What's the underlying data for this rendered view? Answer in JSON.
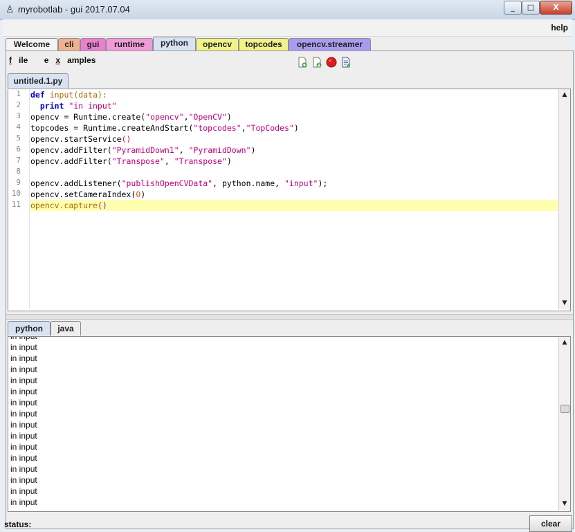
{
  "window": {
    "title": "myrobotlab - gui 2017.07.04",
    "min": "_",
    "max": "□",
    "close": "X"
  },
  "menu": {
    "help": "help"
  },
  "tabs": [
    {
      "label": "Welcome",
      "color": "#f4f4f4"
    },
    {
      "label": "cli",
      "color": "#f1b18e"
    },
    {
      "label": "gui",
      "color": "#ec7fd1"
    },
    {
      "label": "runtime",
      "color": "#f19ad9"
    },
    {
      "label": "python",
      "color": "#d7e3f3"
    },
    {
      "label": "opencv",
      "color": "#f2f28a"
    },
    {
      "label": "topcodes",
      "color": "#f2f28a"
    },
    {
      "label": "opencv.streamer",
      "color": "#a99cf0"
    }
  ],
  "python_panel": {
    "file_first": "f",
    "file_rest": "ile",
    "examples_pre": "e",
    "examples_u": "x",
    "examples_post": "amples",
    "toolbar": [
      "new-file-icon",
      "open-file-icon",
      "stop-icon",
      "save-file-icon"
    ],
    "doc_tab": "untitled.1.py"
  },
  "code": {
    "line_numbers": [
      "1",
      "2",
      "3",
      "4",
      "5",
      "6",
      "7",
      "8",
      "9",
      "10",
      "11"
    ],
    "lines": [
      [
        {
          "t": "def ",
          "c": "kw"
        },
        {
          "t": "input",
          "c": "fn"
        },
        {
          "t": "(data):",
          "c": "fn"
        }
      ],
      [
        {
          "t": "  print ",
          "c": "kw"
        },
        {
          "t": "\"in input\"",
          "c": "st"
        }
      ],
      [
        {
          "t": "opencv = Runtime.create(",
          "c": ""
        },
        {
          "t": "\"opencv\"",
          "c": "st"
        },
        {
          "t": ",",
          "c": ""
        },
        {
          "t": "\"OpenCV\"",
          "c": "st"
        },
        {
          "t": ")",
          "c": ""
        }
      ],
      [
        {
          "t": "topcodes = Runtime.createAndStart(",
          "c": ""
        },
        {
          "t": "\"topcodes\"",
          "c": "st"
        },
        {
          "t": ",",
          "c": ""
        },
        {
          "t": "\"TopCodes\"",
          "c": "st"
        },
        {
          "t": ")",
          "c": ""
        }
      ],
      [
        {
          "t": "opencv.startService",
          "c": ""
        },
        {
          "t": "()",
          "c": "st"
        }
      ],
      [
        {
          "t": "opencv.addFilter(",
          "c": ""
        },
        {
          "t": "\"PyramidDown1\"",
          "c": "st"
        },
        {
          "t": ", ",
          "c": ""
        },
        {
          "t": "\"PyramidDown\"",
          "c": "st"
        },
        {
          "t": ")",
          "c": ""
        }
      ],
      [
        {
          "t": "opencv.addFilter(",
          "c": ""
        },
        {
          "t": "\"Transpose\"",
          "c": "st"
        },
        {
          "t": ", ",
          "c": ""
        },
        {
          "t": "\"Transpose\"",
          "c": "st"
        },
        {
          "t": ")",
          "c": ""
        }
      ],
      [],
      [
        {
          "t": "opencv.addListener(",
          "c": ""
        },
        {
          "t": "\"publishOpenCVData\"",
          "c": "st"
        },
        {
          "t": ", python.name, ",
          "c": ""
        },
        {
          "t": "\"input\"",
          "c": "st"
        },
        {
          "t": ");",
          "c": ""
        }
      ],
      [
        {
          "t": "opencv.setCameraIndex(",
          "c": ""
        },
        {
          "t": "0",
          "c": "nm"
        },
        {
          "t": ")",
          "c": ""
        }
      ],
      [
        {
          "t": "opencv.capture",
          "c": "fn"
        },
        {
          "t": "()",
          "c": "st"
        }
      ]
    ]
  },
  "bottom_tabs": [
    "python",
    "java"
  ],
  "output": {
    "lines": [
      "in input",
      "in input",
      "in input",
      "in input",
      "in input",
      "in input",
      "in input",
      "in input",
      "in input",
      "in input",
      "in input",
      "in input",
      "in input",
      "in input",
      "in input",
      "in input"
    ]
  },
  "status": {
    "label": "status:",
    "clear_button": "clear"
  }
}
